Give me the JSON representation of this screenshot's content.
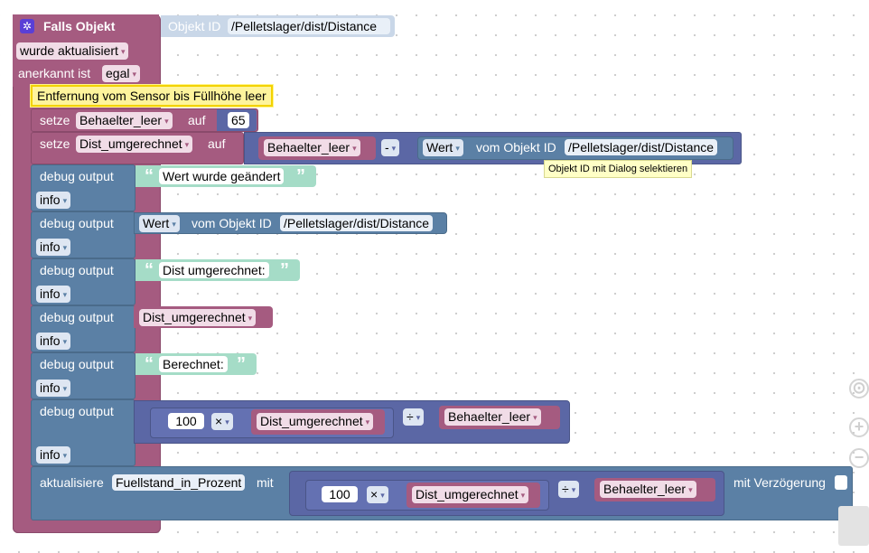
{
  "trigger": {
    "title": "Falls Objekt",
    "object_id_label": "Objekt ID",
    "object_id_value": "/Pelletslager/dist/Distance",
    "event_dropdown": "wurde aktualisiert",
    "ack_label": "anerkannt ist",
    "ack_dropdown": "egal"
  },
  "comment": "Entfernung vom Sensor bis Füllhöhe leer",
  "set1": {
    "keyword": "setze",
    "var": "Behaelter_leer",
    "to": "auf",
    "value": "65"
  },
  "set2": {
    "keyword": "setze",
    "var": "Dist_umgerechnet",
    "to": "auf",
    "left_var": "Behaelter_leer",
    "operator": "-",
    "value_dropdown": "Wert",
    "from_label": "vom Objekt ID",
    "object_id": "/Pelletslager/dist/Distance"
  },
  "tooltip": "Objekt ID mit Dialog selektieren",
  "debug_label": "debug output",
  "debug_level": "info",
  "debug1": {
    "text": "Wert wurde geändert"
  },
  "debug2": {
    "value_dropdown": "Wert",
    "from_label": "vom Objekt ID",
    "object_id": "/Pelletslager/dist/Distance"
  },
  "debug3": {
    "text": "Dist umgerechnet:"
  },
  "debug4": {
    "var": "Dist_umgerechnet"
  },
  "debug5": {
    "text": "Berechnet:"
  },
  "debug6": {
    "number": "100",
    "mul_op": "×",
    "var": "Dist_umgerechnet",
    "div_op": "÷",
    "divisor": "Behaelter_leer"
  },
  "update": {
    "keyword": "aktualisiere",
    "target": "Fuellstand_in_Prozent",
    "with": "mit",
    "number": "100",
    "mul_op": "×",
    "var": "Dist_umgerechnet",
    "div_op": "÷",
    "divisor": "Behaelter_leer",
    "delay_label": "mit Verzögerung"
  },
  "glyphs": {
    "open_quote": "“",
    "close_quote": "”",
    "caret": "▾"
  },
  "icons": {
    "trigger_icon": "gear-icon",
    "zoom_reset": "target-icon",
    "zoom_in": "plus-icon",
    "zoom_out": "minus-icon"
  },
  "colors": {
    "trigger": "#a55b80",
    "control": "#5b80a5",
    "math": "#5b67a5",
    "string": "#a5dcc7",
    "object": "#c9d7e8"
  }
}
